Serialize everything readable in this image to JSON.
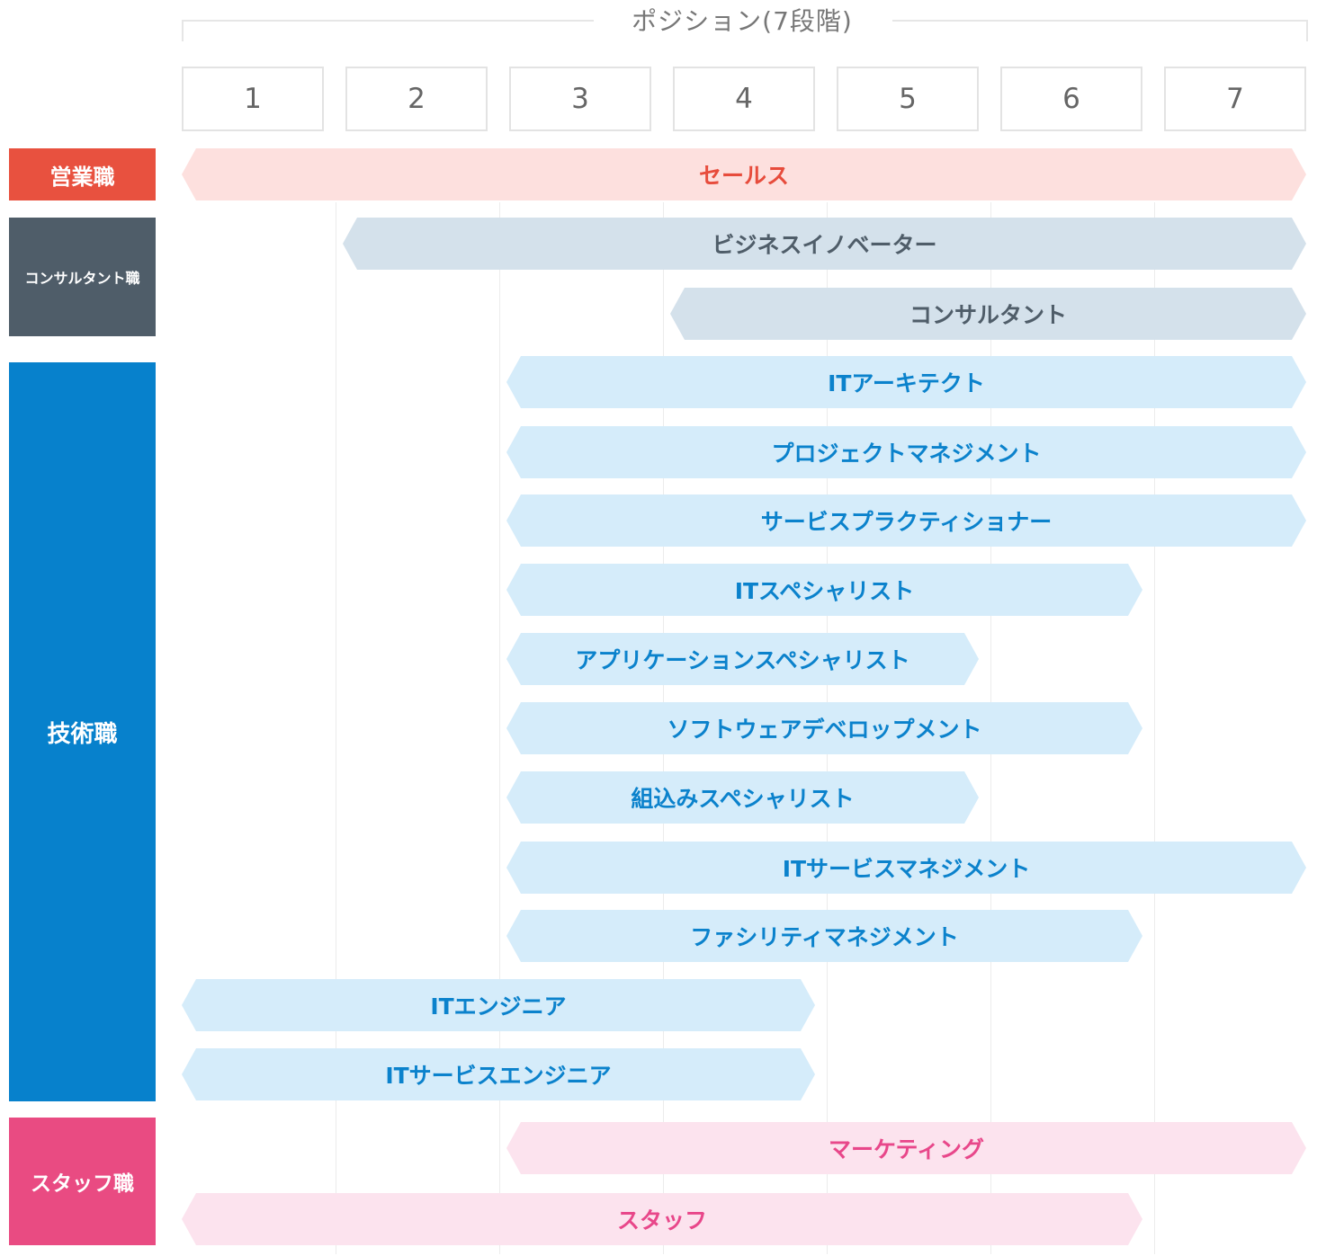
{
  "header": {
    "title": "ポジション(7段階)",
    "positions": [
      "1",
      "2",
      "3",
      "4",
      "5",
      "6",
      "7"
    ]
  },
  "categories": {
    "sales": "営業職",
    "consultant": "コンサルタント職",
    "technical": "技術職",
    "staff": "スタッフ職"
  },
  "colors": {
    "sales": "#e8513f",
    "consultant": "#4f5d69",
    "technical": "#0781cc",
    "staff": "#e94b82"
  },
  "roles": [
    {
      "label": "セールス",
      "category": "sales",
      "from": 1,
      "to": 7
    },
    {
      "label": "ビジネスイノベーター",
      "category": "consultant",
      "from": 2,
      "to": 7
    },
    {
      "label": "コンサルタント",
      "category": "consultant",
      "from": 4,
      "to": 7
    },
    {
      "label": "ITアーキテクト",
      "category": "technical",
      "from": 3,
      "to": 7
    },
    {
      "label": "プロジェクトマネジメント",
      "category": "technical",
      "from": 3,
      "to": 7
    },
    {
      "label": "サービスプラクティショナー",
      "category": "technical",
      "from": 3,
      "to": 7
    },
    {
      "label": "ITスペシャリスト",
      "category": "technical",
      "from": 3,
      "to": 6
    },
    {
      "label": "アプリケーションスペシャリスト",
      "category": "technical",
      "from": 3,
      "to": 5
    },
    {
      "label": "ソフトウェアデベロップメント",
      "category": "technical",
      "from": 3,
      "to": 6
    },
    {
      "label": "組込みスペシャリスト",
      "category": "technical",
      "from": 3,
      "to": 5
    },
    {
      "label": "ITサービスマネジメント",
      "category": "technical",
      "from": 3,
      "to": 7
    },
    {
      "label": "ファシリティマネジメント",
      "category": "technical",
      "from": 3,
      "to": 6
    },
    {
      "label": "ITエンジニア",
      "category": "technical",
      "from": 1,
      "to": 4
    },
    {
      "label": "ITサービスエンジニア",
      "category": "technical",
      "from": 1,
      "to": 4
    },
    {
      "label": "マーケティング",
      "category": "staff",
      "from": 3,
      "to": 7
    },
    {
      "label": "スタッフ",
      "category": "staff",
      "from": 1,
      "to": 6
    }
  ]
}
